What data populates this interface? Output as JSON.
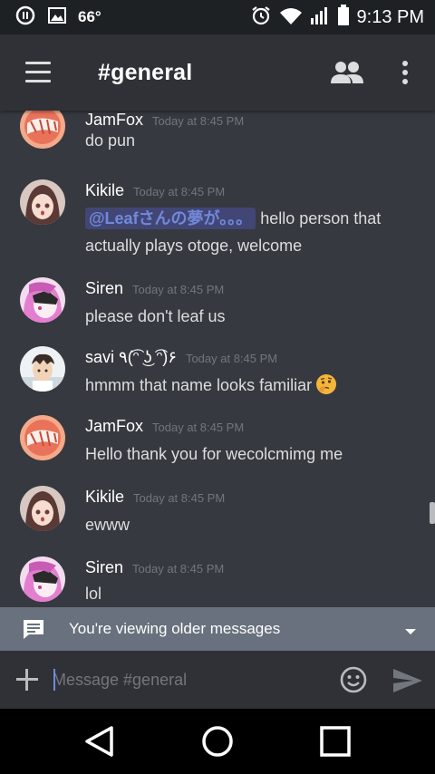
{
  "status_bar": {
    "temperature": "66°",
    "time": "9:13 PM",
    "icons": [
      "data-saver-icon",
      "gallery-icon",
      "alarm-icon",
      "wifi-icon",
      "signal-icon",
      "battery-icon"
    ]
  },
  "header": {
    "channel_title": "#general",
    "icons": [
      "hamburger-menu-icon",
      "members-icon",
      "more-vertical-icon"
    ]
  },
  "messages": [
    {
      "author": "JamFox",
      "timestamp": "Today at 8:45 PM",
      "text": "do pun",
      "avatar": "jamfox-avatar"
    },
    {
      "author": "Kikile",
      "timestamp": "Today at 8:45 PM",
      "mention": "@Leafさんの夢が。。。",
      "text_after_mention": "hello person that actually plays otoge, welcome",
      "avatar": "kikile-avatar"
    },
    {
      "author": "Siren",
      "timestamp": "Today at 8:45 PM",
      "text": "please don't leaf us",
      "avatar": "siren-avatar"
    },
    {
      "author": "savi ٩(͡ᵔ ͜ʖ ͡ᵔ)۶",
      "timestamp": "Today at 8:45 PM",
      "text": "hmmm that name looks familiar",
      "emoji": "thinking-face-emoji",
      "avatar": "savi-avatar"
    },
    {
      "author": "JamFox",
      "timestamp": "Today at 8:45 PM",
      "text": "Hello thank you for wecolcmimg me",
      "avatar": "jamfox-avatar"
    },
    {
      "author": "Kikile",
      "timestamp": "Today at 8:45 PM",
      "text": "ewww",
      "avatar": "kikile-avatar"
    },
    {
      "author": "Siren",
      "timestamp": "Today at 8:45 PM",
      "text": "lol",
      "avatar": "siren-avatar"
    }
  ],
  "older_messages_bar": {
    "text": "You're viewing older messages",
    "icons": [
      "chat-bubble-icon",
      "caret-down-icon"
    ]
  },
  "composer": {
    "placeholder": "Message #general",
    "value": "",
    "icons": [
      "plus-icon",
      "emoji-smiley-icon",
      "send-icon"
    ]
  },
  "nav_bar": {
    "icons": [
      "back-triangle-icon",
      "home-circle-icon",
      "recents-square-icon"
    ]
  },
  "colors": {
    "background": "#36393f",
    "header": "#2f3136",
    "mention_text": "#7289da",
    "mention_bg": "#414675",
    "older_bar": "#68717d",
    "timestamp": "#72767d"
  }
}
